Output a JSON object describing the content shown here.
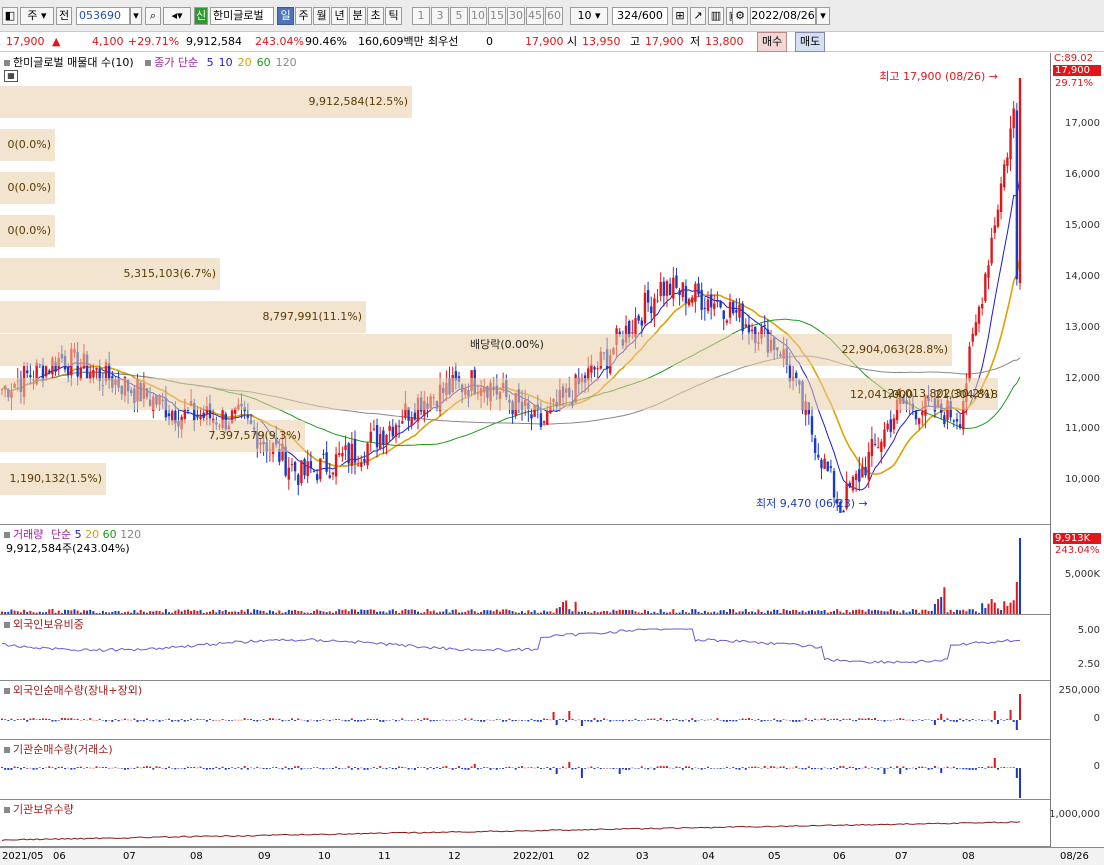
{
  "toolbar": {
    "period": "주",
    "prev": "전",
    "code": "053690",
    "credit_tag": "신",
    "stock_name": "한미글로벌",
    "tabs": [
      "일",
      "주",
      "월",
      "년",
      "분",
      "초",
      "틱"
    ],
    "active_tab": "일",
    "intervals": [
      "1",
      "3",
      "5",
      "10",
      "15",
      "30",
      "45",
      "60"
    ],
    "interval_value": "10",
    "count": "324",
    "max_count": "/600",
    "date": "2022/08/26"
  },
  "quote": {
    "price": "17,900",
    "change": "4,100",
    "change_pct": "+29.71%",
    "volume": "9,912,584",
    "vol_ratio": "243.04%",
    "turnover": "90.46%",
    "amount": "160,609백만",
    "pref_label": "최우선",
    "pref_value": "0",
    "pref_price": "17,900",
    "open_label": "시",
    "open": "13,950",
    "high_label": "고",
    "high": "17,900",
    "low_label": "저",
    "low": "13,800",
    "buy": "매수",
    "sell": "매도"
  },
  "price_pane": {
    "title": "한미글로벌 매물대 수(10)",
    "ma_label": "종가 단순",
    "ma": [
      {
        "p": "5",
        "color": "#1a1ad0"
      },
      {
        "p": "10",
        "color": "#1a1ad0"
      },
      {
        "p": "20",
        "color": "#e0a000"
      },
      {
        "p": "60",
        "color": "#1a9a1a"
      },
      {
        "p": "120",
        "color": "#888888"
      }
    ],
    "high_note": "최고 17,900 (08/26)",
    "low_note": "최저 9,470 (06/23)",
    "div_note": "배당락(0.00%)",
    "axis_label_top": "C:89.02",
    "axis_price": "17,900",
    "axis_pct": "29.71%",
    "ticks": [
      "17,000",
      "16,000",
      "15,000",
      "14,000",
      "13,000",
      "12,000",
      "11,000",
      "10,000"
    ],
    "volume_profile": [
      "9,912,584(12.5%)",
      "0(0.0%)",
      "0(0.0%)",
      "0(0.0%)",
      "5,315,103(6.7%)",
      "8,797,991(11.1%)",
      "22,904,063(28.8%)",
      "24,013,802(30.2%)",
      "7,397,579(9.3%)",
      "1,190,132(1.5%)"
    ],
    "vp_overlap": "12,041,000",
    "vp_overlap2": "21,304,818"
  },
  "chart_data": {
    "type": "candlestick",
    "title": "한미글로벌",
    "x_range": [
      "2021/05",
      "2022/08/26"
    ],
    "ylim": [
      9400,
      17900
    ],
    "ohlc_last": {
      "date": "2022/08/26",
      "open": 13950,
      "high": 17900,
      "low": 13800,
      "close": 17900
    },
    "series_close_approx": [
      {
        "x": "2021/05",
        "y": 11800
      },
      {
        "x": "2021/06",
        "y": 12400
      },
      {
        "x": "2021/07",
        "y": 11900
      },
      {
        "x": "2021/08",
        "y": 11300
      },
      {
        "x": "2021/09",
        "y": 11200
      },
      {
        "x": "2021/10",
        "y": 10100
      },
      {
        "x": "2021/11",
        "y": 10600
      },
      {
        "x": "2021/12",
        "y": 11600
      },
      {
        "x": "2022/01",
        "y": 12000
      },
      {
        "x": "2022/02",
        "y": 11100
      },
      {
        "x": "2022/03",
        "y": 12300
      },
      {
        "x": "2022/04",
        "y": 13800
      },
      {
        "x": "2022/05",
        "y": 13500
      },
      {
        "x": "2022/06",
        "y": 12600
      },
      {
        "x": "2022/06/23",
        "y": 9470
      },
      {
        "x": "2022/07",
        "y": 11500
      },
      {
        "x": "2022/08",
        "y": 11300
      },
      {
        "x": "2022/08/26",
        "y": 17900
      }
    ]
  },
  "volume_pane": {
    "title": "거래량",
    "ma_label": "단순",
    "ma": [
      "5",
      "20",
      "60",
      "120"
    ],
    "value": "9,912,584주(243.04%)",
    "axis_value": "9,913K",
    "axis_pct": "243.04%",
    "tick": "5,000K"
  },
  "foreign_pane": {
    "title": "외국인보유비중",
    "ticks": [
      "5.00",
      "2.50"
    ]
  },
  "foreign_net_pane": {
    "title": "외국인순매수량(장내+장외)",
    "ticks": [
      "250,000",
      "0"
    ]
  },
  "inst_net_pane": {
    "title": "기관순매수량(거래소)",
    "ticks": [
      "0"
    ]
  },
  "inst_hold_pane": {
    "title": "기관보유수량",
    "ticks": [
      "1,000,000"
    ]
  },
  "x_axis": [
    "2021/05",
    "06",
    "07",
    "08",
    "09",
    "10",
    "11",
    "12",
    "2022/01",
    "02",
    "03",
    "04",
    "05",
    "06",
    "07",
    "08",
    "08/26"
  ]
}
